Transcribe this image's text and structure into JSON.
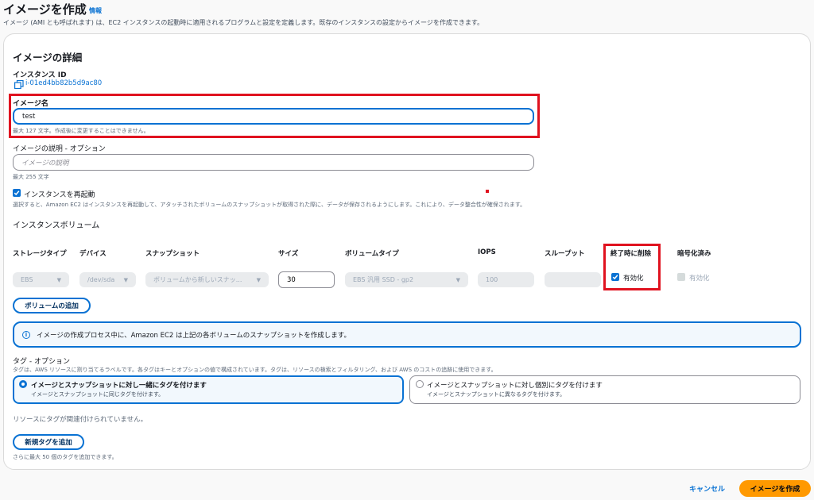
{
  "page": {
    "title": "イメージを作成",
    "info_link": "情報",
    "description": "イメージ (AMI とも呼ばれます) は、EC2 インスタンスの起動時に適用されるプログラムと設定を定義します。既存のインスタンスの設定からイメージを作成できます。"
  },
  "details": {
    "section_title": "イメージの詳細",
    "instance_id_label": "インスタンス ID",
    "instance_id": "i-01ed4bb82b5d9ac80",
    "image_name_label": "イメージ名",
    "image_name_value": "test",
    "image_name_hint": "最大 127 文字。作成後に変更することはできません。",
    "image_desc_label": "イメージの説明 - オプション",
    "image_desc_placeholder": "イメージの説明",
    "image_desc_hint": "最大 255 文字",
    "reboot_label": "インスタンスを再起動",
    "reboot_checked": true,
    "reboot_hint": "選択すると、Amazon EC2 はインスタンスを再起動して、アタッチされたボリュームのスナップショットが取得された際に、データが保存されるようにします。これにより、データ整合性が確保されます。"
  },
  "volumes": {
    "title": "インスタンスボリューム",
    "headers": [
      "ストレージタイプ",
      "デバイス",
      "スナップショット",
      "サイズ",
      "ボリュームタイプ",
      "IOPS",
      "スループット",
      "終了時に削除",
      "暗号化済み"
    ],
    "row": {
      "storage_type": "EBS",
      "device": "/dev/sda",
      "snapshot": "ボリュームから新しいスナッ...",
      "size": "30",
      "volume_type": "EBS 汎用 SSD - gp2",
      "iops": "100",
      "throughput": "",
      "delete_on_termination_label": "有効化",
      "delete_on_termination": true,
      "encrypted_label": "有効化",
      "encrypted": false
    },
    "add_volume_button": "ボリュームの追加",
    "alert_text": "イメージの作成プロセス中に、Amazon EC2 は上記の各ボリュームのスナップショットを作成します。"
  },
  "tags": {
    "label": "タグ - オプション",
    "hint": "タグは、AWS リソースに割り当てるラベルです。各タグはキーとオプションの値で構成されています。タグは、リソースの検索とフィルタリング、および AWS のコストの追跡に使用できます。",
    "option_together_title": "イメージとスナップショットに対し一緒にタグを付けます",
    "option_together_sub": "イメージとスナップショットに同じタグを付けます。",
    "option_separate_title": "イメージとスナップショットに対し個別にタグを付けます",
    "option_separate_sub": "イメージとスナップショットに異なるタグを付けます。",
    "selected": "together",
    "no_tags_text": "リソースにタグが関連付けられていません。",
    "add_tag_button": "新規タグを追加",
    "add_tag_hint": "さらに最大 50 個のタグを追加できます。"
  },
  "footer": {
    "cancel": "キャンセル",
    "create": "イメージを作成"
  },
  "colors": {
    "accent": "#0972d3",
    "primary_button": "#ff9900",
    "highlight_box": "#e0121f"
  }
}
